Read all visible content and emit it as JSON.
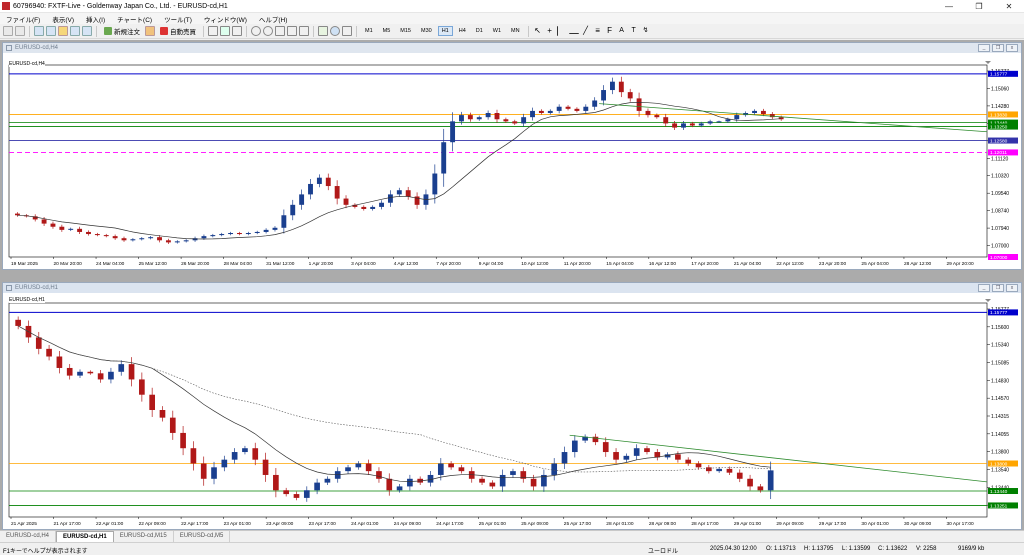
{
  "window": {
    "title": "60796940: FXTF-Live - Goldenway Japan Co., Ltd. - EURUSD-cd,H1"
  },
  "menu": [
    "ファイル(F)",
    "表示(V)",
    "挿入(I)",
    "チャート(C)",
    "ツール(T)",
    "ウィンドウ(W)",
    "ヘルプ(H)"
  ],
  "toolbar": {
    "new_order": "新規注文",
    "auto_trade": "自動売買",
    "timeframes": [
      "M1",
      "M5",
      "M15",
      "M30",
      "H1",
      "H4",
      "D1",
      "W1",
      "MN"
    ],
    "active_timeframe": "H1"
  },
  "chart_h4": {
    "window_title": "EURUSD-cd,H4",
    "label": "EURUSD-cd,H4",
    "chart_data": {
      "type": "candlestick",
      "symbol": "EURUSD-cd",
      "timeframe": "H4",
      "price_ticks": [
        "1.15777",
        "1.15060",
        "1.14280",
        "1.13510",
        "1.12740",
        "1.11120",
        "1.10320",
        "1.09540",
        "1.08740",
        "1.07940",
        "1.07000"
      ],
      "time_labels": [
        "19 Mar 2025",
        "20 Mar 20:00",
        "24 Mar 04:00",
        "25 Mar 12:00",
        "26 Mar 20:00",
        "28 Mar 04:00",
        "31 Mar 12:00",
        "1 Apr 20:00",
        "3 Apr 04:00",
        "4 Apr 12:00",
        "7 Apr 20:00",
        "9 Apr 04:00",
        "10 Apr 12:00",
        "11 Apr 20:00",
        "15 Apr 04:00",
        "16 Apr 12:00",
        "17 Apr 20:00",
        "21 Apr 04:00",
        "22 Apr 12:00",
        "23 Apr 20:00",
        "25 Apr 04:00",
        "28 Apr 12:00",
        "29 Apr 20:00"
      ],
      "ylim": [
        1.07,
        1.162
      ],
      "closes": [
        1.09,
        1.0895,
        1.088,
        1.086,
        1.0845,
        1.083,
        1.0835,
        1.082,
        1.081,
        1.0805,
        1.08,
        1.079,
        1.078,
        1.0785,
        1.079,
        1.0795,
        1.078,
        1.077,
        1.0775,
        1.078,
        1.079,
        1.08,
        1.0805,
        1.081,
        1.0815,
        1.081,
        1.0815,
        1.082,
        1.083,
        1.084,
        1.09,
        1.095,
        1.1,
        1.105,
        1.108,
        1.104,
        1.098,
        1.095,
        1.094,
        1.093,
        1.094,
        1.096,
        1.1,
        1.102,
        1.099,
        1.095,
        1.1,
        1.11,
        1.125,
        1.135,
        1.138,
        1.136,
        1.137,
        1.139,
        1.136,
        1.135,
        1.134,
        1.137,
        1.14,
        1.139,
        1.14,
        1.142,
        1.141,
        1.14,
        1.142,
        1.145,
        1.15,
        1.154,
        1.149,
        1.146,
        1.14,
        1.138,
        1.137,
        1.134,
        1.132,
        1.134,
        1.133,
        1.134,
        1.135,
        1.135,
        1.136,
        1.138,
        1.139,
        1.14,
        1.1385,
        1.137,
        1.136
      ],
      "levels": [
        {
          "name": "upper-blue",
          "value": 1.15777,
          "color": "#0000cc",
          "style": "solid"
        },
        {
          "name": "orange",
          "value": 1.1383,
          "color": "#ffa500",
          "style": "solid"
        },
        {
          "name": "green-1",
          "value": 1.1344,
          "color": "#008000",
          "style": "solid"
        },
        {
          "name": "green-2",
          "value": 1.1325,
          "color": "#008000",
          "style": "solid"
        },
        {
          "name": "navy",
          "value": 1.1258,
          "color": "#3333aa",
          "style": "solid"
        },
        {
          "name": "magenta",
          "value": 1.12011,
          "color": "#ff00ff",
          "style": "dashed"
        }
      ],
      "price_tags": [
        {
          "text": "1.15777",
          "color": "#0000cc"
        },
        {
          "text": "1.13830",
          "color": "#ffa500"
        },
        {
          "text": "1.13440",
          "color": "#008000"
        },
        {
          "text": "1.13250",
          "color": "#008000"
        },
        {
          "text": "1.12580",
          "color": "#3333aa"
        },
        {
          "text": "1.12011",
          "color": "#ff00ff"
        },
        {
          "text": "1.07000",
          "color": "#ff00ff"
        }
      ]
    }
  },
  "chart_h1": {
    "window_title": "EURUSD-cd,H1",
    "label": "EURUSD-cd,H1",
    "chart_data": {
      "type": "candlestick",
      "symbol": "EURUSD-cd",
      "timeframe": "H1",
      "price_ticks": [
        "1.15777",
        "1.15600",
        "1.15340",
        "1.15085",
        "1.14830",
        "1.14570",
        "1.14315",
        "1.14055",
        "1.13800",
        "1.13540",
        "1.13440",
        "1.13251"
      ],
      "time_labels": [
        "21 Apr 2025",
        "21 Apr 17:00",
        "22 Apr 01:00",
        "22 Apr 09:00",
        "22 Apr 17:00",
        "23 Apr 01:00",
        "23 Apr 09:00",
        "23 Apr 17:00",
        "24 Apr 01:00",
        "24 Apr 09:00",
        "24 Apr 17:00",
        "25 Apr 01:00",
        "25 Apr 09:00",
        "25 Apr 17:00",
        "28 Apr 01:00",
        "28 Apr 09:00",
        "28 Apr 17:00",
        "29 Apr 01:00",
        "29 Apr 09:00",
        "29 Apr 17:00",
        "30 Apr 01:00",
        "30 Apr 09:00",
        "30 Apr 17:00"
      ],
      "ylim": [
        1.131,
        1.159
      ],
      "closes": [
        1.156,
        1.1545,
        1.153,
        1.152,
        1.1505,
        1.1495,
        1.15,
        1.1498,
        1.149,
        1.15,
        1.151,
        1.149,
        1.147,
        1.145,
        1.144,
        1.142,
        1.14,
        1.138,
        1.136,
        1.1375,
        1.1385,
        1.1395,
        1.14,
        1.1385,
        1.1365,
        1.1345,
        1.134,
        1.1335,
        1.1345,
        1.1355,
        1.136,
        1.137,
        1.1375,
        1.138,
        1.137,
        1.136,
        1.1345,
        1.135,
        1.136,
        1.1355,
        1.1365,
        1.138,
        1.1375,
        1.137,
        1.136,
        1.1355,
        1.135,
        1.1365,
        1.137,
        1.136,
        1.135,
        1.1365,
        1.138,
        1.1395,
        1.141,
        1.1415,
        1.1408,
        1.1395,
        1.1385,
        1.139,
        1.14,
        1.1395,
        1.1388,
        1.1392,
        1.1385,
        1.138,
        1.1375,
        1.137,
        1.1373,
        1.1368,
        1.136,
        1.135,
        1.1345,
        1.1371
      ],
      "levels": [
        {
          "name": "upper-blue",
          "value": 1.15777,
          "color": "#0000cc",
          "style": "solid"
        },
        {
          "name": "orange",
          "value": 1.138,
          "color": "#ffa500",
          "style": "solid"
        },
        {
          "name": "green-1",
          "value": 1.1344,
          "color": "#008000",
          "style": "solid"
        },
        {
          "name": "green-2",
          "value": 1.13251,
          "color": "#008000",
          "style": "solid"
        }
      ],
      "price_tags": [
        {
          "text": "1.15777",
          "color": "#0000cc"
        },
        {
          "text": "1.13800",
          "color": "#ffa500"
        },
        {
          "text": "1.13440",
          "color": "#008000"
        },
        {
          "text": "1.13251",
          "color": "#008000"
        }
      ]
    }
  },
  "tabs": [
    "EURUSD-cd,H4",
    "EURUSD-cd,H1",
    "EURUSD-cd,M15",
    "EURUSD-cd,M5"
  ],
  "active_tab": "EURUSD-cd,H1",
  "status": {
    "help": "F1キーでヘルプが表示されます",
    "profile": "ユーロドル",
    "datetime": "2025.04.30 12:00",
    "open": "O: 1.13713",
    "high": "H: 1.13795",
    "low": "L: 1.13599",
    "close": "C: 1.13622",
    "volume": "V: 2258",
    "traffic": "9169/9 kb"
  },
  "colors": {
    "bull": "#1a3f8f",
    "bear": "#b01818",
    "ma": "#333333",
    "accent": "#c0282d"
  }
}
